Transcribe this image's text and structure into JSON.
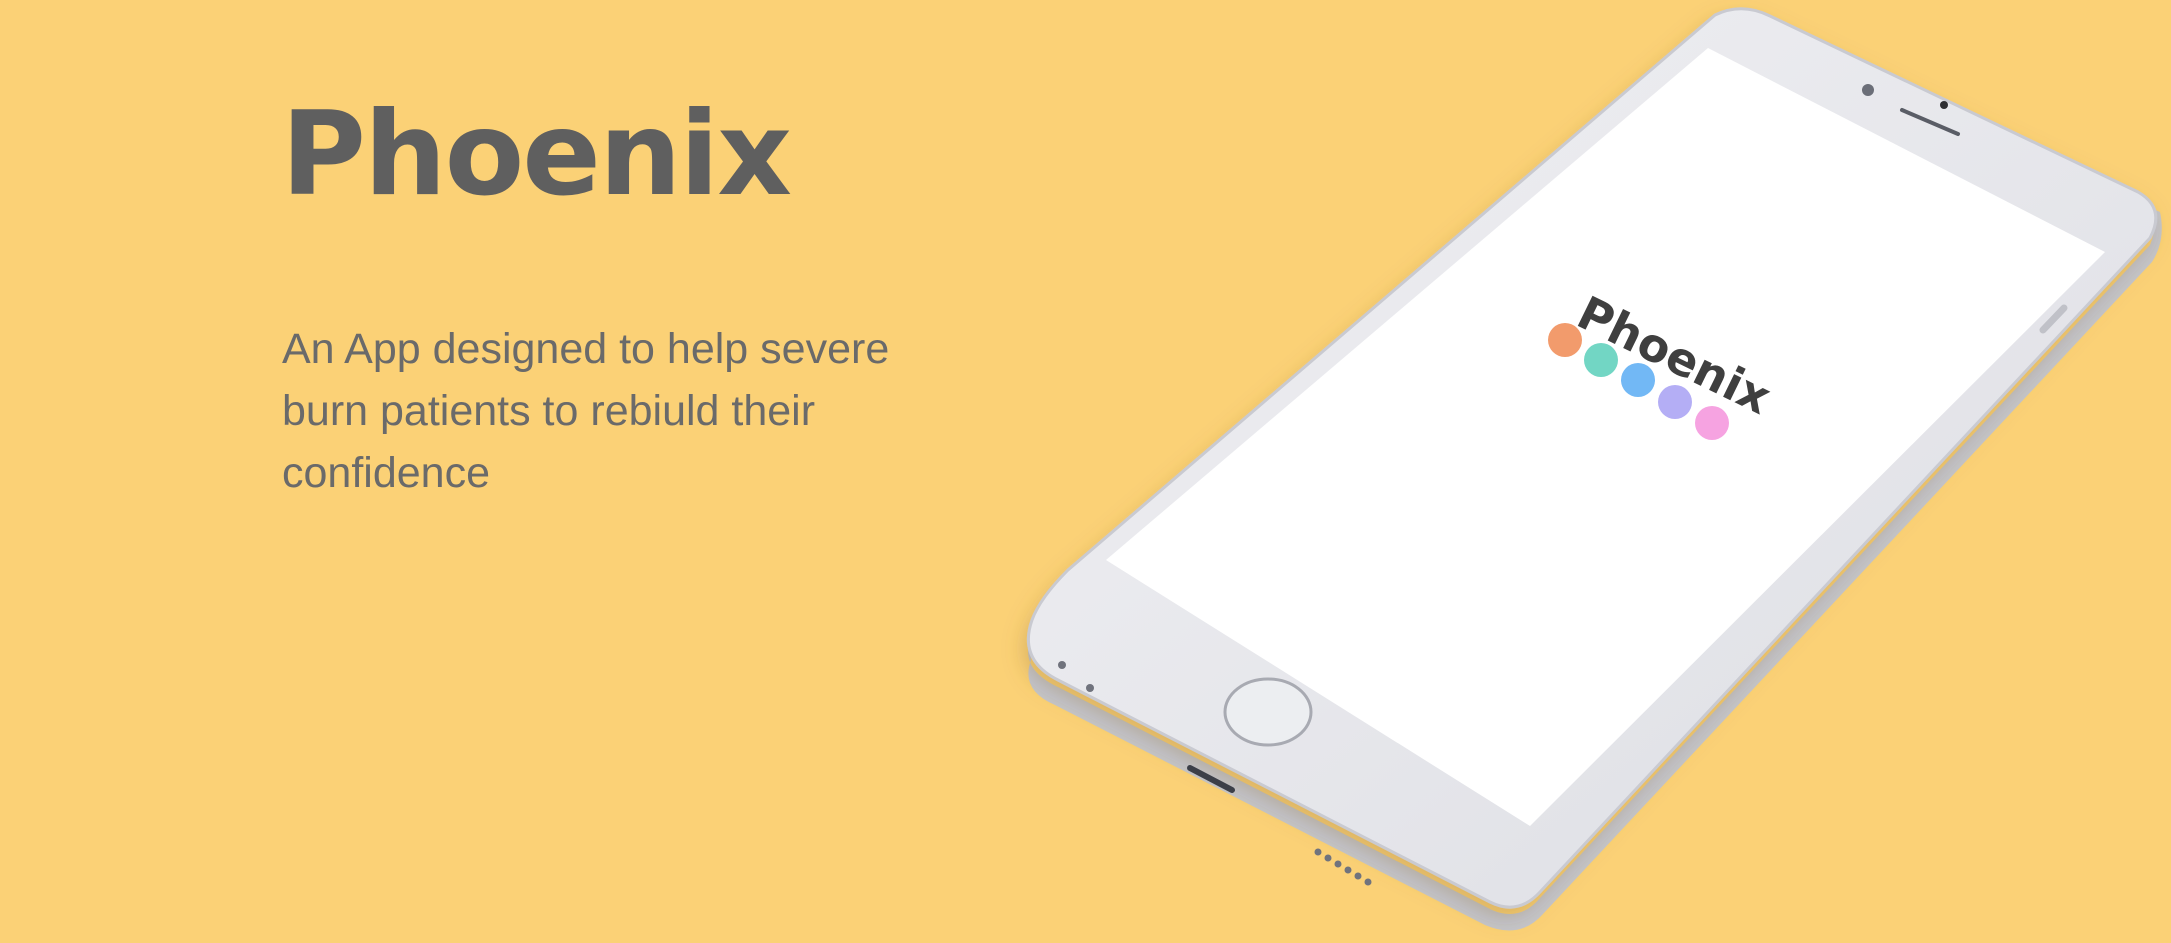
{
  "hero": {
    "title": "Phoenix",
    "tagline": "An App designed to help severe burn patients to rebiuld their confidence"
  },
  "phone_screen": {
    "logo_text": "Phoenix",
    "dot_colors": [
      "#f29b6c",
      "#72d6c4",
      "#72b8f5",
      "#b4aef5",
      "#f6a3e1"
    ]
  },
  "colors": {
    "background": "#fbd176",
    "heading": "#5f5f5f",
    "body_text": "#6a6a6a",
    "phone_body": "#eaeaee",
    "phone_edge": "#c4c5cc"
  }
}
